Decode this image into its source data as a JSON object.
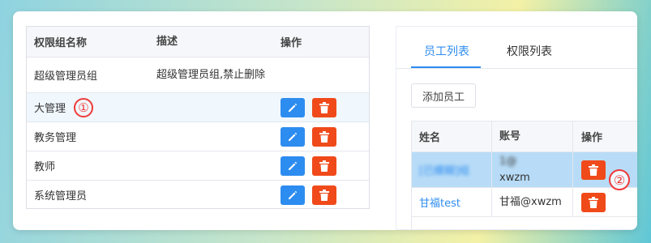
{
  "left_table": {
    "headers": [
      "权限组名称",
      "描述",
      "操作"
    ],
    "rows": [
      {
        "name": "超级管理员组",
        "desc": "超级管理员组,禁止删除",
        "actions": []
      },
      {
        "name": "大管理",
        "desc": "",
        "actions": [
          "edit-icon",
          "delete-icon"
        ],
        "marker": "①"
      },
      {
        "name": "教务管理",
        "desc": "",
        "actions": [
          "edit-icon",
          "delete-icon"
        ]
      },
      {
        "name": "教师",
        "desc": "",
        "actions": [
          "edit-icon",
          "delete-icon"
        ]
      },
      {
        "name": "系统管理员",
        "desc": "",
        "actions": [
          "edit-icon",
          "delete-icon"
        ]
      }
    ]
  },
  "right_panel": {
    "tabs": [
      {
        "label": "员工列表",
        "active": true
      },
      {
        "label": "权限列表",
        "active": false
      }
    ],
    "add_button_label": "添加员工",
    "table": {
      "headers": [
        "姓名",
        "账号",
        "操作"
      ],
      "rows": [
        {
          "name": "[已模糊]组",
          "account_line1": "1@",
          "account_line2": "xwzm",
          "actions": [
            "delete-icon"
          ],
          "selected": true,
          "marker": "②"
        },
        {
          "name": "甘福test",
          "account_line1": "甘福@xwzm",
          "account_line2": "",
          "actions": [
            "delete-icon"
          ],
          "selected": false
        }
      ]
    }
  },
  "colors": {
    "primary": "#2d8cf0",
    "danger": "#f04a1a",
    "marker": "#ef3a3a",
    "selected_row": "#b8dcf7"
  }
}
